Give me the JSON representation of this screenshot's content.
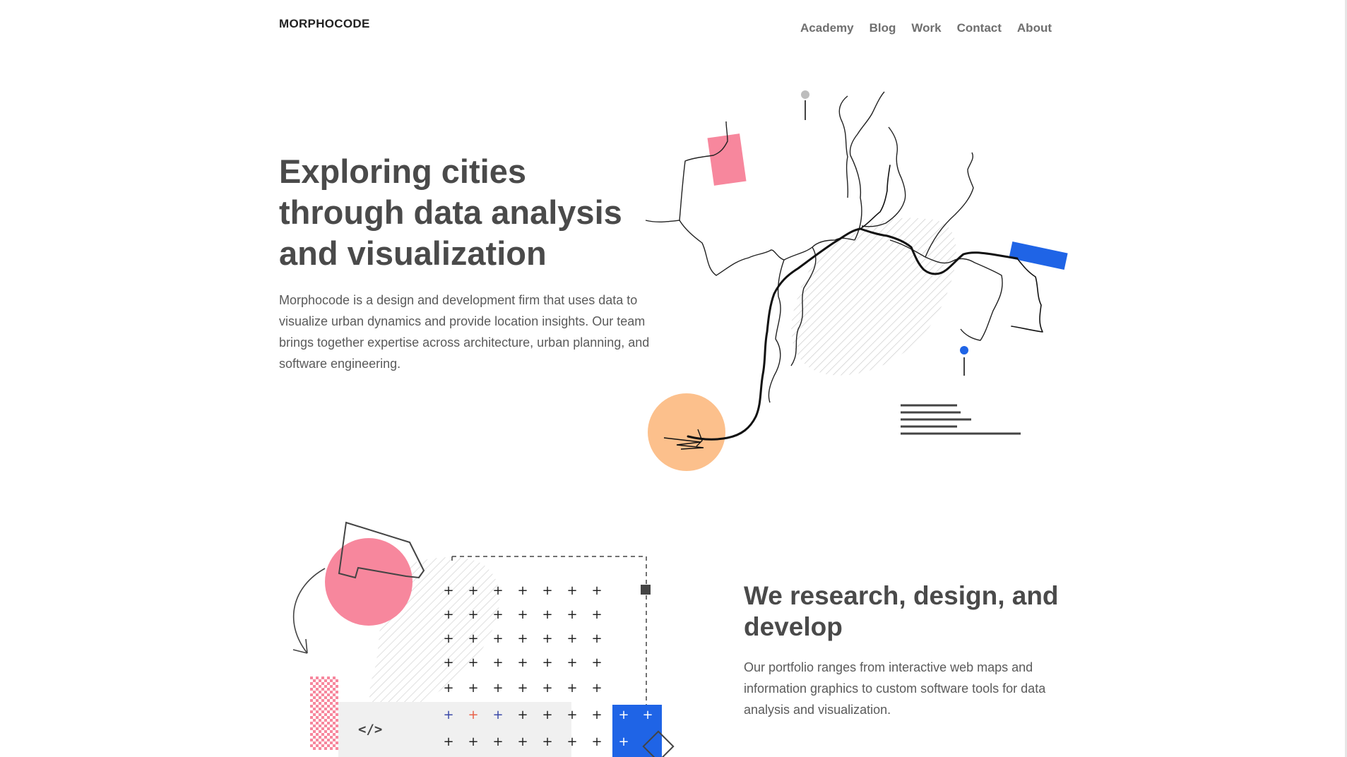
{
  "header": {
    "logo": "MORPHOCODE",
    "nav": [
      "Academy",
      "Blog",
      "Work",
      "Contact",
      "About"
    ]
  },
  "hero": {
    "title_lines": [
      "Exploring cities",
      "through data analysis",
      "and visualization"
    ],
    "description": "Morphocode is a design and development firm that uses data to visualize urban dynamics and provide location insights. Our team brings together expertise across architecture, urban planning, and software engineering."
  },
  "section2": {
    "title_lines": [
      "We research, design, and",
      "develop"
    ],
    "description": "Our portfolio ranges from interactive web maps and information graphics to custom software tools for data analysis and visualization.",
    "code_icon": "</>"
  },
  "colors": {
    "pink": "#f7879d",
    "blue": "#1f64e6",
    "peach": "#fcc08c",
    "text": "#4a4a4a",
    "nav": "#6f6f6f"
  },
  "icons": [
    "map-illustration",
    "location-pin-icon",
    "code-icon",
    "plus-grid",
    "curved-arrow-icon"
  ]
}
